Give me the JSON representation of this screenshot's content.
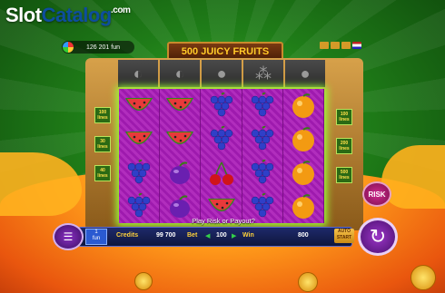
{
  "watermark": {
    "brand_a": "Slot",
    "brand_b": "Catalog",
    "suffix": ".com"
  },
  "balance": {
    "value": "126 201 fun"
  },
  "title": "500 JUICY FRUITS",
  "header_icons": [
    "sound-icon",
    "settings-icon",
    "info-icon",
    "flag-uk-icon"
  ],
  "lines_left": [
    "100 lines",
    "30 lines",
    "40 lines"
  ],
  "lines_right": [
    "100 lines",
    "200 lines",
    "500 lines"
  ],
  "reels": [
    [
      "watermelon",
      "watermelon",
      "grapes",
      "grapes"
    ],
    [
      "watermelon",
      "watermelon",
      "plum",
      "plum"
    ],
    [
      "grapes",
      "grapes",
      "cherries",
      "watermelon"
    ],
    [
      "grapes",
      "grapes",
      "grapes",
      "grapes"
    ],
    [
      "orange",
      "orange",
      "orange",
      "orange"
    ]
  ],
  "ghost_symbols": [
    "watermelon",
    "lemon",
    "plum",
    "grapes",
    "orange"
  ],
  "message": "Play Risk or Payout?",
  "risk_label": "RISK",
  "bottom": {
    "lines_value": "1",
    "lines_unit": "fun",
    "credits_label": "Credits",
    "credits_value": "99 700",
    "bet_label": "Bet",
    "bet_value": "100",
    "win_label": "Win",
    "win_value": "800",
    "autostart_label": "AUTO START",
    "menu_icon": "menu-icon",
    "spin_icon": "spin-icon"
  },
  "colors": {
    "accent_green": "#9bff3a",
    "reel_bg": "#a91fb6",
    "title_text": "#ffcc2a"
  }
}
